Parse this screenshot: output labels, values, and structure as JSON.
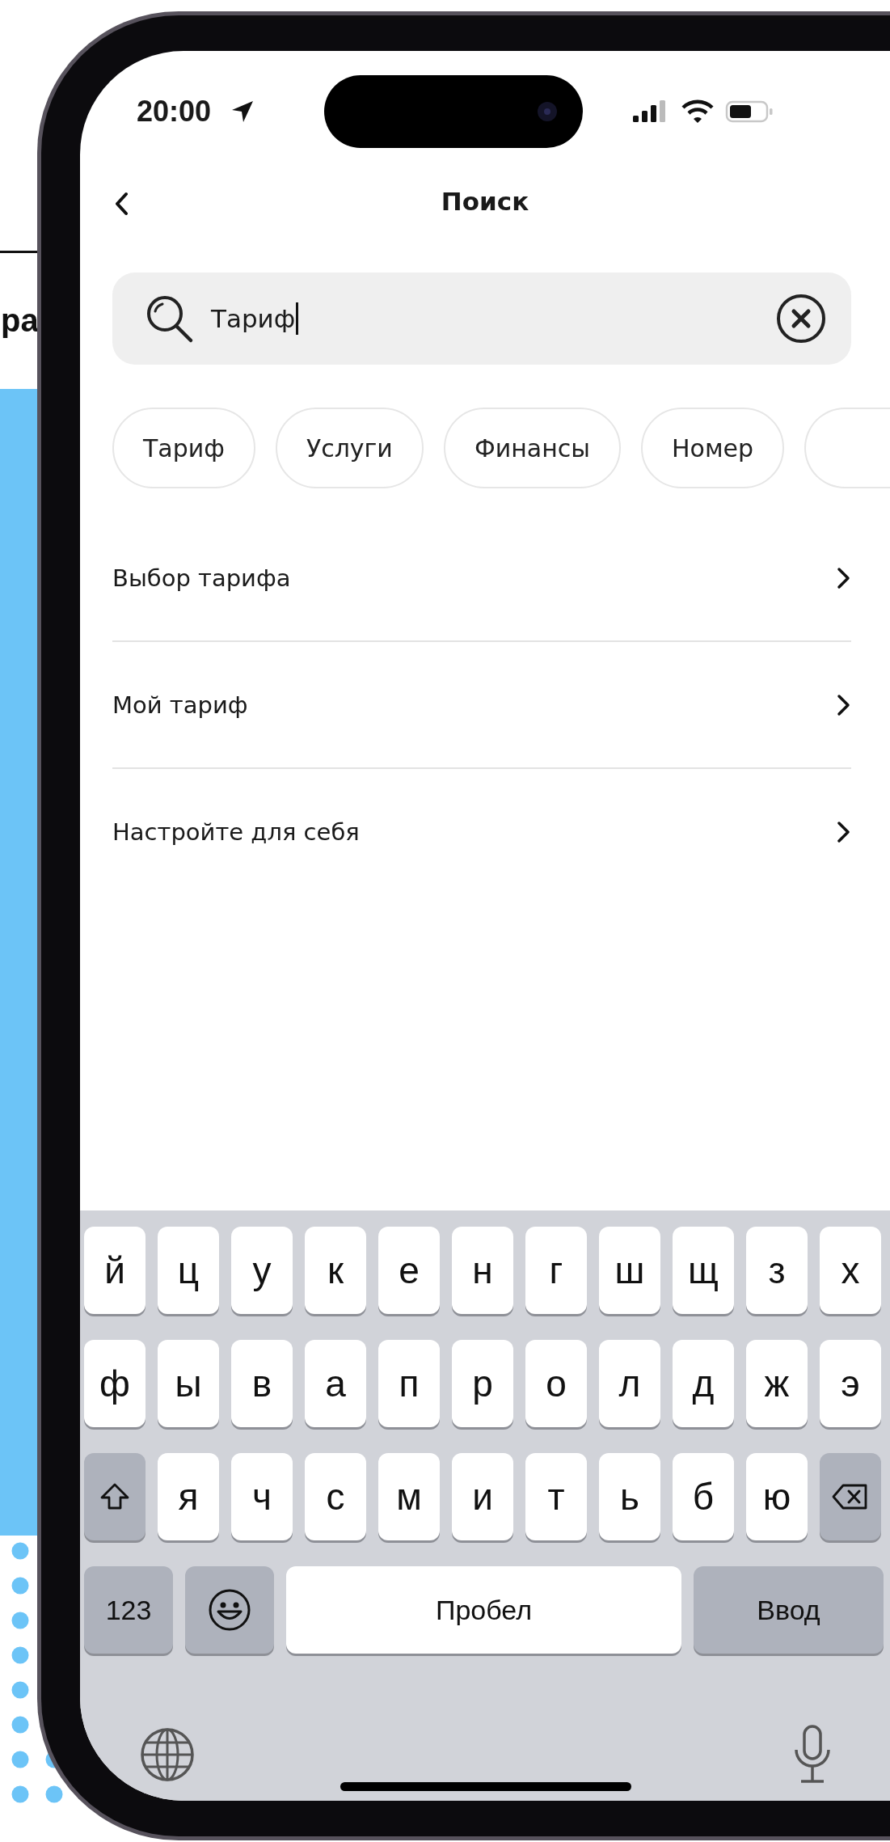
{
  "background": {
    "heading_fragment": "ра"
  },
  "status_bar": {
    "time": "20:00"
  },
  "header": {
    "title": "Поиск"
  },
  "search": {
    "value": "Тариф"
  },
  "chips": [
    {
      "label": "Тариф"
    },
    {
      "label": "Услуги"
    },
    {
      "label": "Финансы"
    },
    {
      "label": "Номер"
    }
  ],
  "results": [
    {
      "label": "Выбор тарифа"
    },
    {
      "label": "Мой тариф"
    },
    {
      "label": "Настройте для себя"
    }
  ],
  "keyboard": {
    "rows": [
      [
        {
          "kind": "letter",
          "label": "й"
        },
        {
          "kind": "letter",
          "label": "ц"
        },
        {
          "kind": "letter",
          "label": "у"
        },
        {
          "kind": "letter",
          "label": "к"
        },
        {
          "kind": "letter",
          "label": "е"
        },
        {
          "kind": "letter",
          "label": "н"
        },
        {
          "kind": "letter",
          "label": "г"
        },
        {
          "kind": "letter",
          "label": "ш"
        },
        {
          "kind": "letter",
          "label": "щ"
        },
        {
          "kind": "letter",
          "label": "з"
        },
        {
          "kind": "letter",
          "label": "х"
        }
      ],
      [
        {
          "kind": "letter",
          "label": "ф"
        },
        {
          "kind": "letter",
          "label": "ы"
        },
        {
          "kind": "letter",
          "label": "в"
        },
        {
          "kind": "letter",
          "label": "а"
        },
        {
          "kind": "letter",
          "label": "п"
        },
        {
          "kind": "letter",
          "label": "р"
        },
        {
          "kind": "letter",
          "label": "о"
        },
        {
          "kind": "letter",
          "label": "л"
        },
        {
          "kind": "letter",
          "label": "д"
        },
        {
          "kind": "letter",
          "label": "ж"
        },
        {
          "kind": "letter",
          "label": "э"
        }
      ],
      [
        {
          "kind": "shift"
        },
        {
          "kind": "letter",
          "label": "я"
        },
        {
          "kind": "letter",
          "label": "ч"
        },
        {
          "kind": "letter",
          "label": "с"
        },
        {
          "kind": "letter",
          "label": "м"
        },
        {
          "kind": "letter",
          "label": "и"
        },
        {
          "kind": "letter",
          "label": "т"
        },
        {
          "kind": "letter",
          "label": "ь"
        },
        {
          "kind": "letter",
          "label": "б"
        },
        {
          "kind": "letter",
          "label": "ю"
        },
        {
          "kind": "backspace"
        }
      ]
    ],
    "number_key": "123",
    "space_key": "Пробел",
    "return_key": "Ввод"
  }
}
